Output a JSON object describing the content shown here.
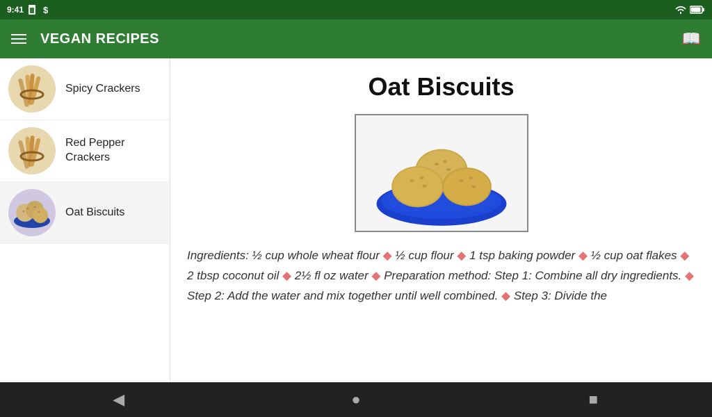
{
  "statusBar": {
    "time": "9:41",
    "icons": [
      "sim",
      "wifi",
      "battery"
    ]
  },
  "appBar": {
    "title": "VEGAN RECIPES",
    "bookmarkLabel": "📖"
  },
  "sidebar": {
    "items": [
      {
        "id": "spicy-crackers",
        "label": "Spicy Crackers",
        "active": false
      },
      {
        "id": "red-pepper-crackers",
        "label": "Red Pepper Crackers",
        "active": false
      },
      {
        "id": "oat-biscuits",
        "label": "Oat Biscuits",
        "active": true
      }
    ]
  },
  "detail": {
    "title": "Oat Biscuits",
    "description": "Ingredients: ½ cup whole wheat flour ◆ ½ cup flour ◆ 1 tsp baking powder ◆ ½ cup oat flakes ◆ 2 tbsp coconut oil ◆ 2½ fl oz water ◆ Preparation method: Step 1: Combine all dry ingredients. ◆ Step 2: Add the water and mix together until well combined. ◆ Step 3: Divide the"
  },
  "navBar": {
    "backLabel": "◀",
    "homeLabel": "●",
    "squareLabel": "■"
  }
}
